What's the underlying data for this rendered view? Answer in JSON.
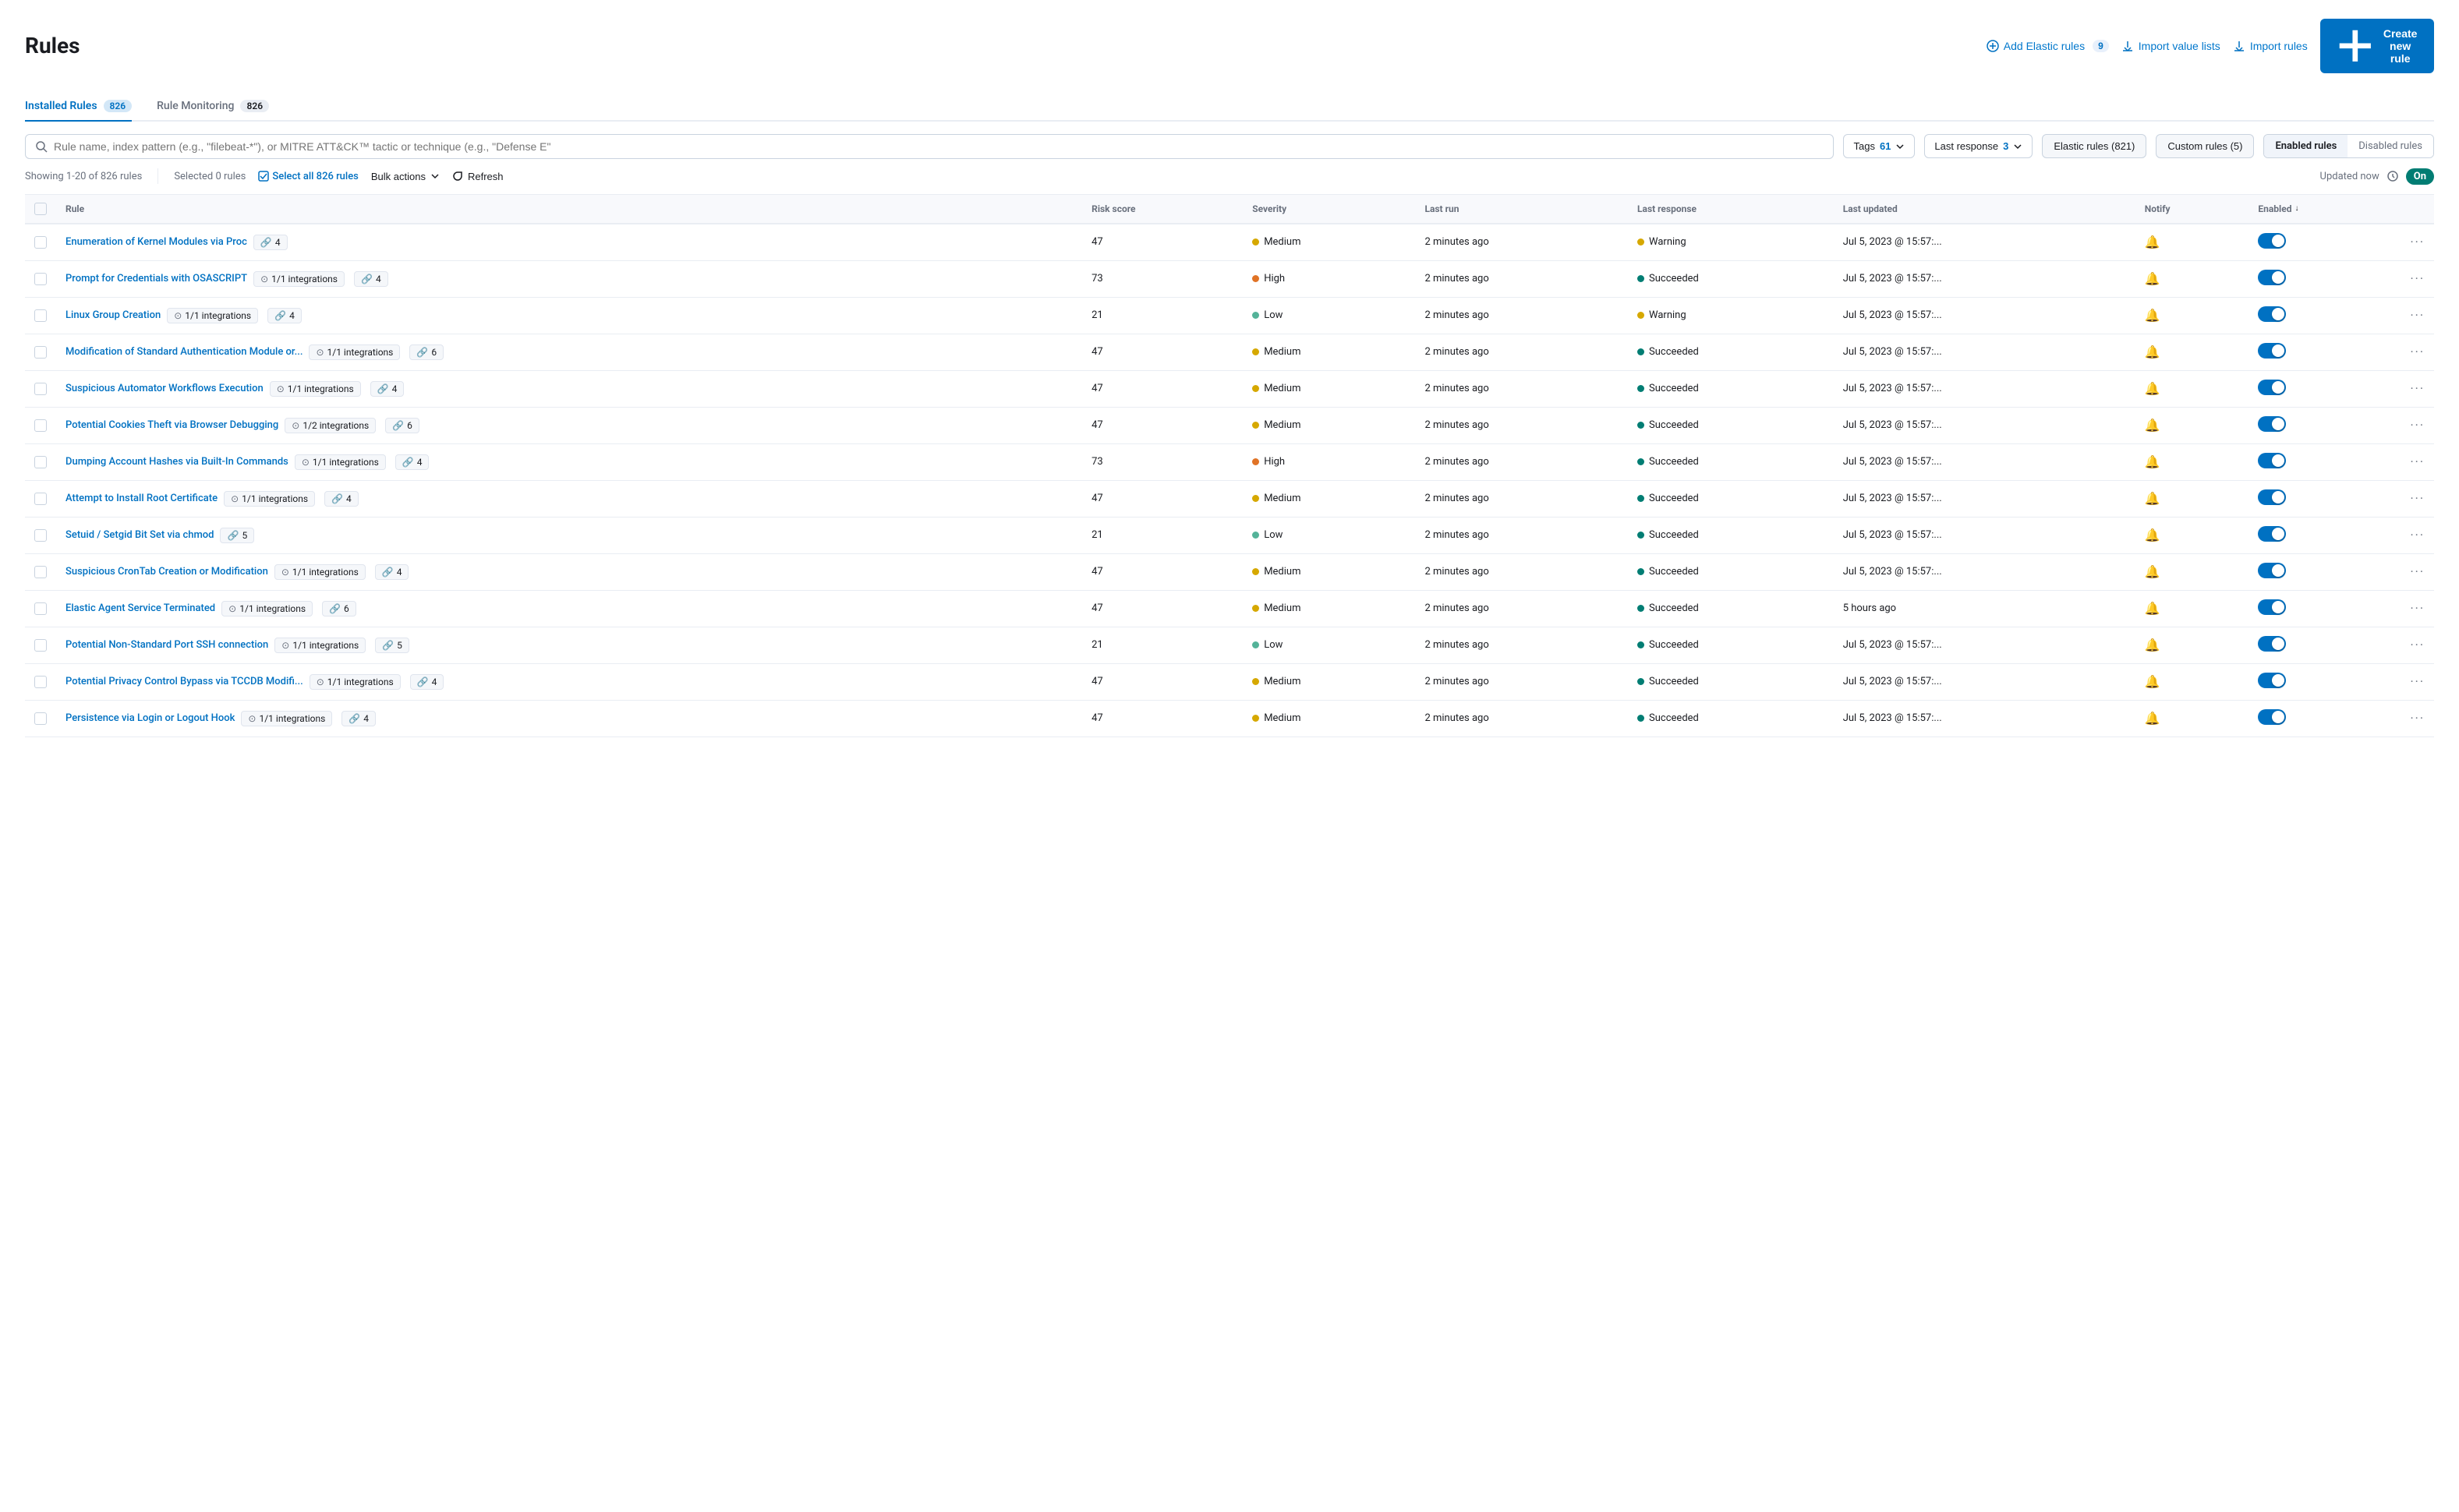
{
  "page": {
    "title": "Rules"
  },
  "header": {
    "add_elastic_label": "Add Elastic rules",
    "add_elastic_count": "9",
    "import_value_label": "Import value lists",
    "import_rules_label": "Import rules",
    "create_label": "Create new rule"
  },
  "tabs": [
    {
      "id": "installed",
      "label": "Installed Rules",
      "count": "826",
      "active": true
    },
    {
      "id": "monitoring",
      "label": "Rule Monitoring",
      "count": "826",
      "active": false
    }
  ],
  "filters": {
    "search_placeholder": "Rule name, index pattern (e.g., \"filebeat-*\"), or MITRE ATT&CK™ tactic or technique (e.g., \"Defense E\"",
    "tags_label": "Tags",
    "tags_count": "61",
    "last_response_label": "Last response",
    "last_response_count": "3",
    "elastic_rules_label": "Elastic rules (821)",
    "custom_rules_label": "Custom rules (5)",
    "enabled_rules_label": "Enabled rules",
    "disabled_rules_label": "Disabled rules"
  },
  "toolbar": {
    "showing_text": "Showing 1-20 of 826 rules",
    "selected_text": "Selected 0 rules",
    "select_all_label": "Select all 826 rules",
    "bulk_actions_label": "Bulk actions",
    "refresh_label": "Refresh",
    "updated_text": "Updated now",
    "on_label": "On"
  },
  "table": {
    "headers": {
      "rule": "Rule",
      "risk_score": "Risk score",
      "severity": "Severity",
      "last_run": "Last run",
      "last_response": "Last response",
      "last_updated": "Last updated",
      "notify": "Notify",
      "enabled": "Enabled"
    },
    "rows": [
      {
        "name": "Enumeration of Kernel Modules via Proc",
        "integrations": null,
        "tags": "4",
        "risk_score": "47",
        "severity": "Medium",
        "severity_type": "medium",
        "last_run": "2 minutes ago",
        "last_response": "Warning",
        "last_response_type": "warning",
        "last_updated": "Jul 5, 2023 @ 15:57:...",
        "enabled": true
      },
      {
        "name": "Prompt for Credentials with OSASCRIPT",
        "integrations": "1/1 integrations",
        "tags": "4",
        "risk_score": "73",
        "severity": "High",
        "severity_type": "high",
        "last_run": "2 minutes ago",
        "last_response": "Succeeded",
        "last_response_type": "success",
        "last_updated": "Jul 5, 2023 @ 15:57:...",
        "enabled": true
      },
      {
        "name": "Linux Group Creation",
        "integrations": "1/1 integrations",
        "tags": "4",
        "risk_score": "21",
        "severity": "Low",
        "severity_type": "low",
        "last_run": "2 minutes ago",
        "last_response": "Warning",
        "last_response_type": "warning",
        "last_updated": "Jul 5, 2023 @ 15:57:...",
        "enabled": true
      },
      {
        "name": "Modification of Standard Authentication Module or...",
        "integrations": "1/1 integrations",
        "tags": "6",
        "risk_score": "47",
        "severity": "Medium",
        "severity_type": "medium",
        "last_run": "2 minutes ago",
        "last_response": "Succeeded",
        "last_response_type": "success",
        "last_updated": "Jul 5, 2023 @ 15:57:...",
        "enabled": true
      },
      {
        "name": "Suspicious Automator Workflows Execution",
        "integrations": "1/1 integrations",
        "tags": "4",
        "risk_score": "47",
        "severity": "Medium",
        "severity_type": "medium",
        "last_run": "2 minutes ago",
        "last_response": "Succeeded",
        "last_response_type": "success",
        "last_updated": "Jul 5, 2023 @ 15:57:...",
        "enabled": true
      },
      {
        "name": "Potential Cookies Theft via Browser Debugging",
        "integrations": "1/2 integrations",
        "tags": "6",
        "risk_score": "47",
        "severity": "Medium",
        "severity_type": "medium",
        "last_run": "2 minutes ago",
        "last_response": "Succeeded",
        "last_response_type": "success",
        "last_updated": "Jul 5, 2023 @ 15:57:...",
        "enabled": true
      },
      {
        "name": "Dumping Account Hashes via Built-In Commands",
        "integrations": "1/1 integrations",
        "tags": "4",
        "risk_score": "73",
        "severity": "High",
        "severity_type": "high",
        "last_run": "2 minutes ago",
        "last_response": "Succeeded",
        "last_response_type": "success",
        "last_updated": "Jul 5, 2023 @ 15:57:...",
        "enabled": true
      },
      {
        "name": "Attempt to Install Root Certificate",
        "integrations": "1/1 integrations",
        "tags": "4",
        "risk_score": "47",
        "severity": "Medium",
        "severity_type": "medium",
        "last_run": "2 minutes ago",
        "last_response": "Succeeded",
        "last_response_type": "success",
        "last_updated": "Jul 5, 2023 @ 15:57:...",
        "enabled": true
      },
      {
        "name": "Setuid / Setgid Bit Set via chmod",
        "integrations": null,
        "tags": "5",
        "risk_score": "21",
        "severity": "Low",
        "severity_type": "low",
        "last_run": "2 minutes ago",
        "last_response": "Succeeded",
        "last_response_type": "success",
        "last_updated": "Jul 5, 2023 @ 15:57:...",
        "enabled": true
      },
      {
        "name": "Suspicious CronTab Creation or Modification",
        "integrations": "1/1 integrations",
        "tags": "4",
        "risk_score": "47",
        "severity": "Medium",
        "severity_type": "medium",
        "last_run": "2 minutes ago",
        "last_response": "Succeeded",
        "last_response_type": "success",
        "last_updated": "Jul 5, 2023 @ 15:57:...",
        "enabled": true
      },
      {
        "name": "Elastic Agent Service Terminated",
        "integrations": "1/1 integrations",
        "tags": "6",
        "risk_score": "47",
        "severity": "Medium",
        "severity_type": "medium",
        "last_run": "2 minutes ago",
        "last_response": "Succeeded",
        "last_response_type": "success",
        "last_updated": "5 hours ago",
        "enabled": true
      },
      {
        "name": "Potential Non-Standard Port SSH connection",
        "integrations": "1/1 integrations",
        "tags": "5",
        "risk_score": "21",
        "severity": "Low",
        "severity_type": "low",
        "last_run": "2 minutes ago",
        "last_response": "Succeeded",
        "last_response_type": "success",
        "last_updated": "Jul 5, 2023 @ 15:57:...",
        "enabled": true
      },
      {
        "name": "Potential Privacy Control Bypass via TCCDB Modifi...",
        "integrations": "1/1 integrations",
        "tags": "4",
        "risk_score": "47",
        "severity": "Medium",
        "severity_type": "medium",
        "last_run": "2 minutes ago",
        "last_response": "Succeeded",
        "last_response_type": "success",
        "last_updated": "Jul 5, 2023 @ 15:57:...",
        "enabled": true
      },
      {
        "name": "Persistence via Login or Logout Hook",
        "integrations": "1/1 integrations",
        "tags": "4",
        "risk_score": "47",
        "severity": "Medium",
        "severity_type": "medium",
        "last_run": "2 minutes ago",
        "last_response": "Succeeded",
        "last_response_type": "success",
        "last_updated": "Jul 5, 2023 @ 15:57:...",
        "enabled": true
      }
    ]
  }
}
